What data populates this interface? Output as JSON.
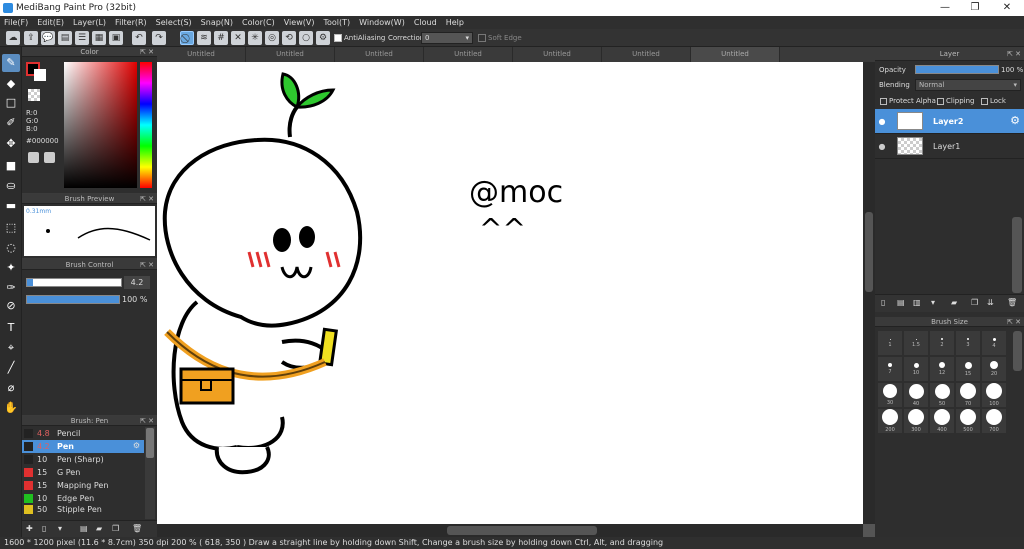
{
  "window": {
    "title": "MediBang Paint Pro (32bit)"
  },
  "menu": [
    "File(F)",
    "Edit(E)",
    "Layer(L)",
    "Filter(R)",
    "Select(S)",
    "Snap(N)",
    "Color(C)",
    "View(V)",
    "Tool(T)",
    "Window(W)",
    "Cloud",
    "Help"
  ],
  "toolbar": {
    "antialiasing_label": "AntiAliasing",
    "correction_label": "Correction",
    "correction_value": "0",
    "soft_edge_label": "Soft Edge"
  },
  "color_panel": {
    "title": "Color",
    "r": "R:0",
    "g": "G:0",
    "b": "B:0",
    "hex": "#000000"
  },
  "brush_preview": {
    "title": "Brush Preview",
    "size_label": "0.31mm"
  },
  "brush_control": {
    "title": "Brush Control",
    "size_value": "4.2",
    "opacity_value": "100 %"
  },
  "brush_panel": {
    "title": "Brush: Pen",
    "items": [
      {
        "size": "4.8",
        "name": "Pencil",
        "color": "#222222"
      },
      {
        "size": "4.2",
        "name": "Pen",
        "color": "#222222"
      },
      {
        "size": "10",
        "name": "Pen (Sharp)",
        "color": "#222222"
      },
      {
        "size": "15",
        "name": "G Pen",
        "color": "#e03030"
      },
      {
        "size": "15",
        "name": "Mapping Pen",
        "color": "#e03030"
      },
      {
        "size": "10",
        "name": "Edge Pen",
        "color": "#20c020"
      },
      {
        "size": "50",
        "name": "Stipple Pen",
        "color": "#e0c020"
      }
    ]
  },
  "tabs": [
    "Untitled",
    "Untitled",
    "Untitled",
    "Untitled",
    "Untitled",
    "Untitled",
    "Untitled"
  ],
  "canvas": {
    "text1": "@moc",
    "text2": "^^"
  },
  "layer_panel": {
    "title": "Layer",
    "opacity_label": "Opacity",
    "opacity_value": "100 %",
    "blending_label": "Blending",
    "blending_value": "Normal",
    "protect_alpha": "Protect Alpha",
    "clipping": "Clipping",
    "lock": "Lock",
    "layers": [
      "Layer2",
      "Layer1"
    ]
  },
  "brush_size_panel": {
    "title": "Brush Size",
    "sizes": [
      "1",
      "1.5",
      "2",
      "3",
      "4",
      "7",
      "10",
      "12",
      "15",
      "20",
      "30",
      "40",
      "50",
      "70",
      "100",
      "200",
      "300",
      "400",
      "500",
      "700"
    ]
  },
  "status": {
    "text": "1600 * 1200 pixel   (11.6 * 8.7cm)   350 dpi   200 %   ( 618, 350 )   Draw a straight line by holding down Shift, Change a brush size by holding down Ctrl, Alt, and dragging"
  },
  "colors": {
    "selection": "#4a90d9",
    "panel": "#2e2e2e"
  }
}
